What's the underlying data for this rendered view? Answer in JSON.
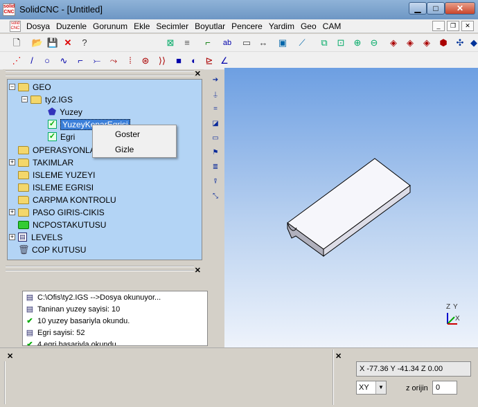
{
  "window": {
    "title": "SolidCNC - [Untitled]",
    "logo_text": "solid CNC"
  },
  "menu": [
    "Dosya",
    "Duzenle",
    "Gorunum",
    "Ekle",
    "Secimler",
    "Boyutlar",
    "Pencere",
    "Yardim",
    "Geo",
    "CAM"
  ],
  "tree": {
    "geo": "GEO",
    "file": "ty2.IGS",
    "yuzey": "Yuzey",
    "selected": "YuzeyKenarEgrisi",
    "egri": "Egri",
    "operasyonlar": "OPERASYONLAR",
    "takimlar": "TAKIMLAR",
    "isleme_yuzeyi": "ISLEME YUZEYI",
    "isleme_egrisi": "ISLEME EGRISI",
    "carpma": "CARPMA KONTROLU",
    "paso": "PASO GIRIS-CIKIS",
    "ncposta": "NCPOSTAKUTUSU",
    "levels": "LEVELS",
    "cop": "COP KUTUSU"
  },
  "context_menu": {
    "show": "Goster",
    "hide": "Gizle"
  },
  "log": [
    "C:\\Ofis\\ty2.IGS -->Dosya okunuyor...",
    "Taninan yuzey sayisi: 10",
    "10  yuzey basariyla okundu.",
    "Egri sayisi:  52",
    "4 egri basariyla okundu."
  ],
  "status": {
    "coordinates": "X -77.36  Y -41.34  Z 0.00",
    "plane": "XY",
    "z_origin_label": "z orijin",
    "z_origin_value": "0"
  },
  "axis_labels": {
    "z": "Z",
    "y": "Y",
    "x": "X"
  },
  "colors": {
    "viewport_top": "#6d9fe2",
    "tree_bg": "#b3d4f5",
    "selection": "#3b7fd9"
  }
}
